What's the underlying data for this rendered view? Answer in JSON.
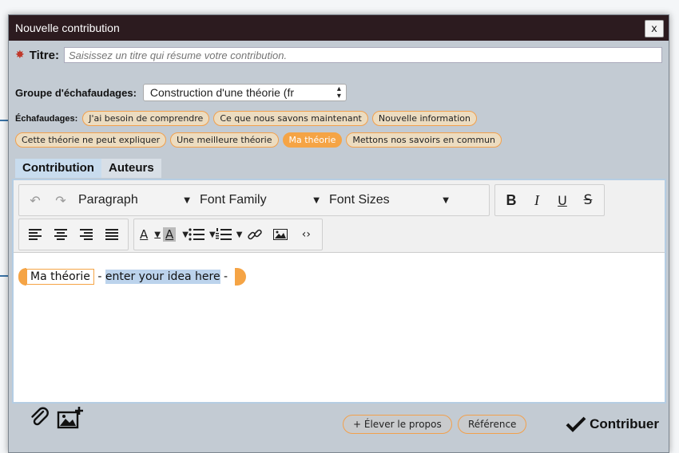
{
  "dialog": {
    "title": "Nouvelle contribution",
    "close_label": "x"
  },
  "title_row": {
    "label": "Titre:",
    "placeholder": "Saisissez un titre qui résume votre contribution."
  },
  "group_row": {
    "label": "Groupe d'échafaudages:",
    "selected": "Construction d'une théorie (fr"
  },
  "scaffolds": {
    "label": "Échafaudages:",
    "row1": [
      "J'ai besoin de comprendre",
      "Ce que nous savons maintenant",
      "Nouvelle information"
    ],
    "row2": [
      "Cette théorie ne peut expliquer",
      "Une meilleure théorie",
      "Ma théorie",
      "Mettons nos savoirs en commun"
    ],
    "active": "Ma théorie"
  },
  "tabs": [
    "Contribution",
    "Auteurs"
  ],
  "toolbar": {
    "block_format": "Paragraph",
    "font_family": "Font Family",
    "font_sizes": "Font Sizes",
    "bold": "B",
    "italic": "I",
    "underline": "U",
    "strike": "S",
    "text_color": "A",
    "bg_color": "A"
  },
  "editor": {
    "tag": "Ma théorie",
    "sep1": " - ",
    "idea": "enter your idea here",
    "sep2": " - "
  },
  "bottom": {
    "elevate_label": "+ Élever le propos",
    "reference_label": "Référence",
    "submit_label": "Contribuer"
  },
  "colors": {
    "titlebar": "#2c1b1f",
    "accent": "#f5a445",
    "dialog_bg": "#c3cbd3",
    "highlight": "#bcd3ec"
  }
}
